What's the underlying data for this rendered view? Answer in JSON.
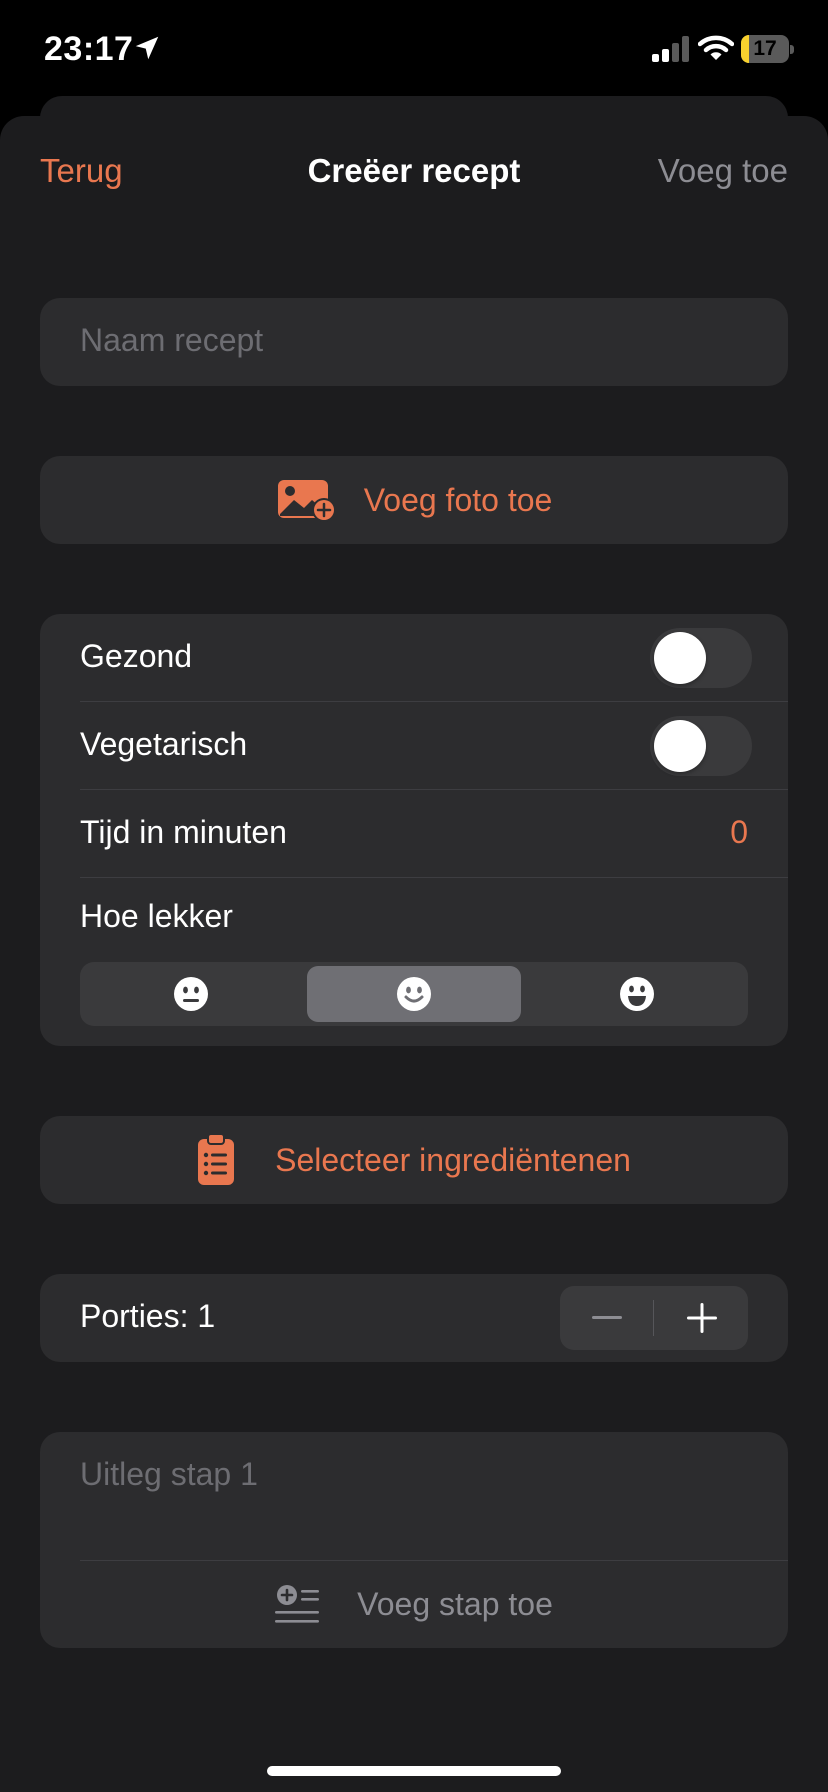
{
  "status_bar": {
    "time": "23:17",
    "battery_level": "17",
    "battery_fraction": 0.17,
    "icons": [
      "location-arrow-icon",
      "cellular-signal-icon",
      "wifi-icon",
      "battery-charging-icon"
    ]
  },
  "nav": {
    "back_label": "Terug",
    "title": "Creëer recept",
    "add_label": "Voeg toe"
  },
  "name_field": {
    "placeholder": "Naam recept"
  },
  "photo_button": {
    "label": "Voeg foto toe",
    "icon": "add-photo-icon"
  },
  "options": {
    "healthy_label": "Gezond",
    "healthy_on": false,
    "vegetarian_label": "Vegetarisch",
    "vegetarian_on": false,
    "time_label": "Tijd in minuten",
    "time_value": "0",
    "tasty_label": "Hoe lekker",
    "tasty_options": [
      "neutral-face-icon",
      "smiling-face-icon",
      "grinning-face-icon"
    ],
    "tasty_selected_index": 1
  },
  "ingredients_button": {
    "label": "Selecteer ingrediëntenen",
    "icon": "clipboard-list-icon"
  },
  "portions": {
    "label": "Porties: 1"
  },
  "steps": {
    "step_placeholder": "Uitleg stap 1",
    "add_step_label": "Voeg stap toe",
    "add_step_icon": "add-list-icon"
  },
  "colors": {
    "accent": "#e9774f",
    "background": "#1c1c1e",
    "card": "#2c2c2e",
    "secondary_text": "#8d8d93"
  }
}
